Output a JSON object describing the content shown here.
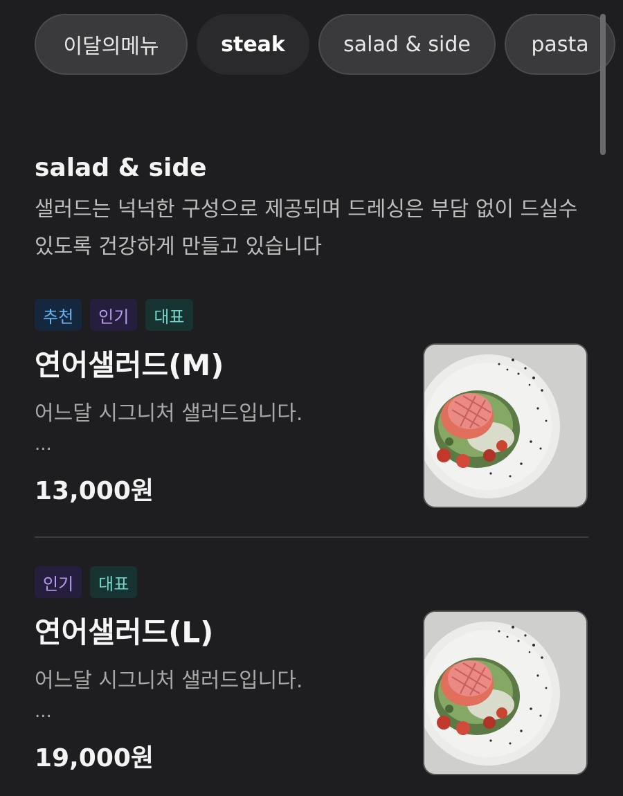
{
  "tabs": [
    {
      "label": "이달의메뉴",
      "active": false
    },
    {
      "label": "steak",
      "active": true
    },
    {
      "label": "salad & side",
      "active": false
    },
    {
      "label": "pasta",
      "active": false
    }
  ],
  "section": {
    "title": "salad & side",
    "description": "샐러드는 넉넉한 구성으로 제공되며 드레싱은 부담 없이 드실수 있도록 건강하게 만들고 있습니다"
  },
  "tag_colors": {
    "추천": "#6ab2f2",
    "인기": "#b69cf0",
    "대표": "#6fd3c5"
  },
  "items": [
    {
      "tags": [
        "추천",
        "인기",
        "대표"
      ],
      "name": "연어샐러드(M)",
      "description": "어느달 시그니처 샐러드입니다.",
      "more": "...",
      "price": "13,000원",
      "image_icon": "salmon-salad-photo"
    },
    {
      "tags": [
        "인기",
        "대표"
      ],
      "name": "연어샐러드(L)",
      "description": "어느달 시그니처 샐러드입니다.",
      "more": "...",
      "price": "19,000원",
      "image_icon": "salmon-salad-photo"
    }
  ]
}
